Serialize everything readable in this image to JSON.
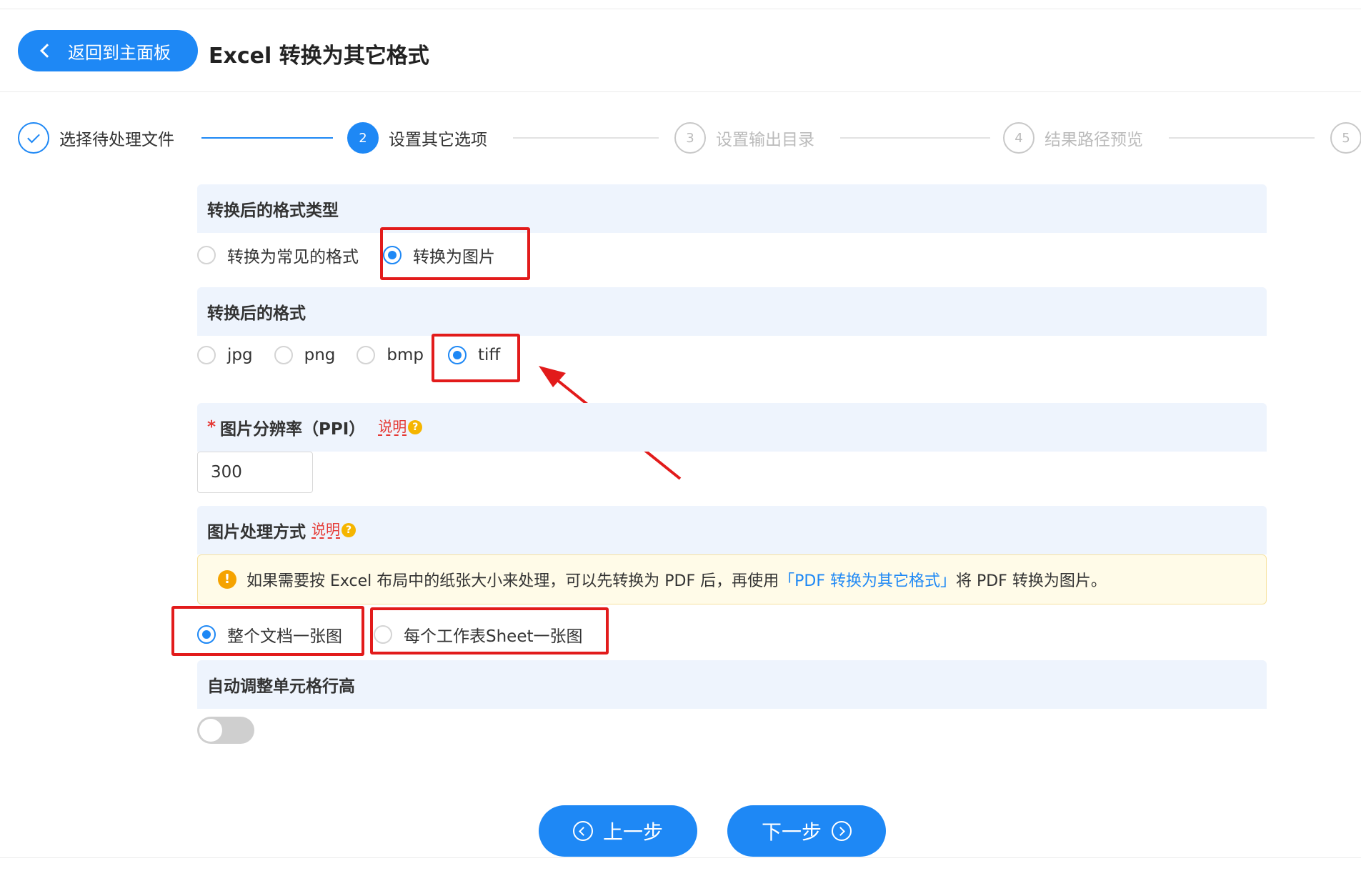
{
  "header": {
    "back_label": "返回到主面板",
    "title": "Excel 转换为其它格式"
  },
  "steps": [
    {
      "number": "",
      "label": "选择待处理文件",
      "state": "done"
    },
    {
      "number": "2",
      "label": "设置其它选项",
      "state": "active"
    },
    {
      "number": "3",
      "label": "设置输出目录",
      "state": "pending"
    },
    {
      "number": "4",
      "label": "结果路径预览",
      "state": "pending"
    },
    {
      "number": "5",
      "label": "",
      "state": "pending"
    }
  ],
  "format_type": {
    "heading": "转换后的格式类型",
    "options": [
      "转换为常见的格式",
      "转换为图片"
    ],
    "selected": "转换为图片"
  },
  "format": {
    "heading": "转换后的格式",
    "options": [
      "jpg",
      "png",
      "bmp",
      "tiff"
    ],
    "selected": "tiff"
  },
  "resolution": {
    "required_mark": "*",
    "heading": "图片分辨率（PPI）",
    "help_label": "说明",
    "value": "300"
  },
  "processing": {
    "heading": "图片处理方式",
    "help_label": "说明",
    "notice_prefix": "如果需要按 Excel 布局中的纸张大小来处理，可以先转换为 PDF 后，再使用",
    "notice_link": "「PDF 转换为其它格式」",
    "notice_suffix": "将 PDF 转换为图片。",
    "options": [
      "整个文档一张图",
      "每个工作表Sheet一张图"
    ],
    "selected": "整个文档一张图"
  },
  "auto_row_height": {
    "heading": "自动调整单元格行高",
    "enabled": false
  },
  "footer": {
    "prev_label": "上一步",
    "next_label": "下一步"
  },
  "colors": {
    "accent": "#1e88f5",
    "annotation_red": "#e21b1b",
    "section_bg": "#eef4fd"
  }
}
